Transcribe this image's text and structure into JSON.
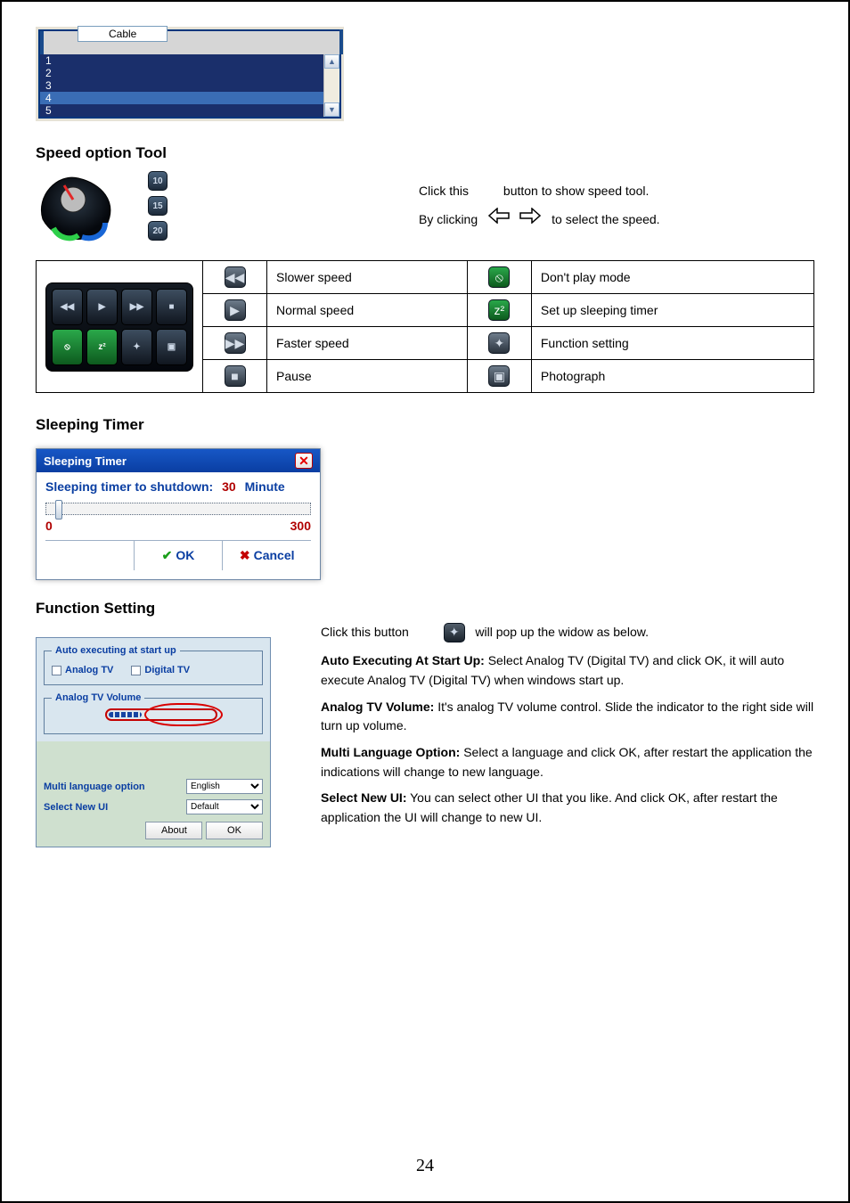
{
  "page_number": "24",
  "cable": {
    "tab": "Cable",
    "items": [
      "1",
      "2",
      "3",
      "4",
      "5"
    ],
    "selected_index": 3
  },
  "speed": {
    "title": "Speed option Tool",
    "intro_left": "Click this",
    "intro_mid": "button to show speed tool.",
    "intro_right": "By clicking",
    "intro_right2": "to select the speed.",
    "labels": [
      "10",
      "15",
      "20"
    ]
  },
  "btns": {
    "head1": "",
    "rows_left": [
      {
        "d": "Slower speed"
      },
      {
        "d": "Normal speed"
      },
      {
        "d": "Faster speed"
      },
      {
        "d": "Pause"
      }
    ],
    "rows_right": [
      {
        "d": "Don't play mode"
      },
      {
        "d": "Set up sleeping timer"
      },
      {
        "d": "Function setting"
      },
      {
        "d": "Photograph"
      }
    ]
  },
  "timer": {
    "section_title": "Sleeping Timer",
    "title": "Sleeping Timer",
    "label": "Sleeping timer to shutdown:",
    "value": "30",
    "unit": "Minute",
    "min": "0",
    "max": "300",
    "ok": "OK",
    "cancel": "Cancel"
  },
  "funcset": {
    "section_title": "Function Setting",
    "click_text": "Click this button",
    "will_pop": "will pop up the widow as below.",
    "auto_legend": "Auto executing at start up",
    "cb1": "Analog TV",
    "cb2": "Digital TV",
    "vol_label": "Analog TV Volume",
    "lang_label": "Multi language option",
    "lang_value": "English",
    "ui_label": "Select New UI",
    "ui_value": "Default",
    "about": "About",
    "ok": "OK",
    "autoexec_title": "Auto Executing At Start Up:",
    "autoexec_body": "Select Analog TV (Digital TV) and click OK, it will auto execute Analog TV (Digital TV) when windows start up.",
    "vol_title": "Analog TV Volume:",
    "vol_body": "It's analog TV volume control. Slide the indicator to the right side will turn up volume.",
    "lang_title": "Multi Language Option:",
    "lang_body": "Select a language and click OK, after restart the application the indications will change to new language.",
    "ui_title": "Select New UI:",
    "ui_body": "You can select other UI that you like. And click OK, after restart the application the UI will change to new UI."
  }
}
